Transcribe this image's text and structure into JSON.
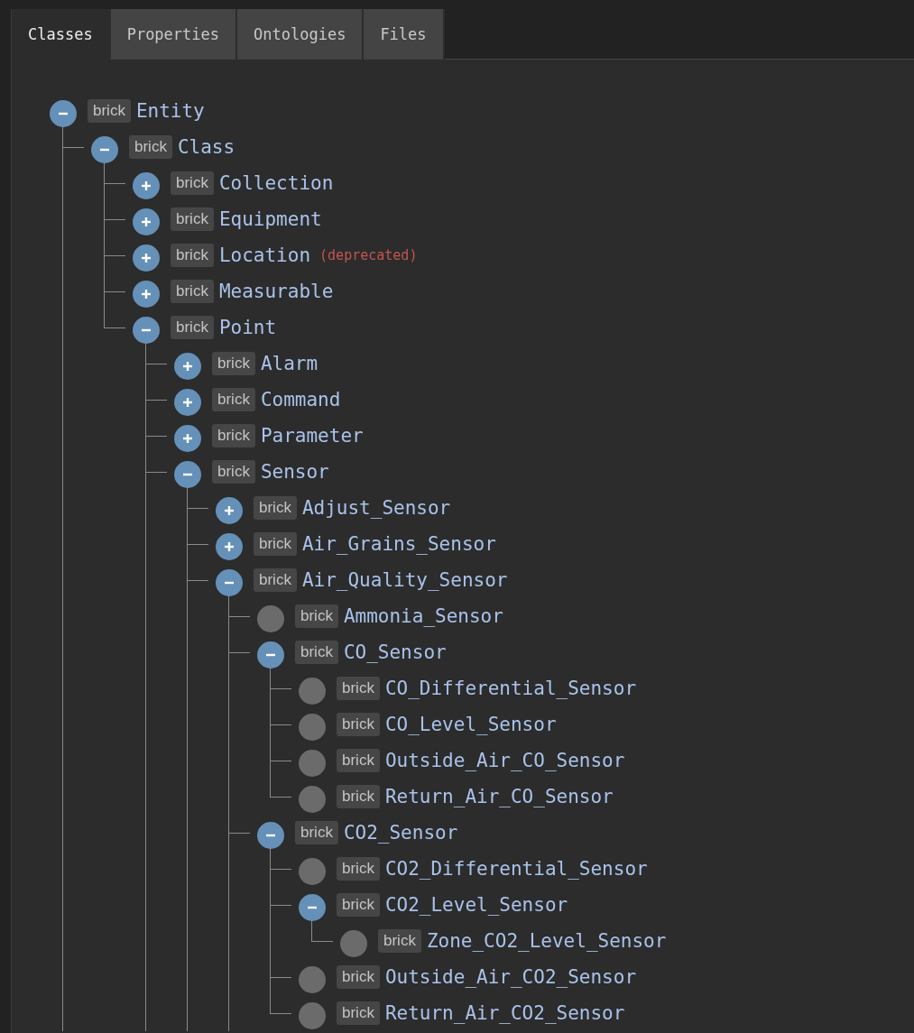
{
  "tabs": [
    {
      "label": "Classes",
      "selected": true
    },
    {
      "label": "Properties",
      "selected": false
    },
    {
      "label": "Ontologies",
      "selected": false
    },
    {
      "label": "Files",
      "selected": false
    }
  ],
  "tree": [
    {
      "prefix": "brick",
      "label": "Entity",
      "kind": "branch",
      "expanded": true,
      "continues": true,
      "children": [
        {
          "prefix": "brick",
          "label": "Class",
          "kind": "branch",
          "expanded": true,
          "children": [
            {
              "prefix": "brick",
              "label": "Collection",
              "kind": "branch",
              "expanded": false
            },
            {
              "prefix": "brick",
              "label": "Equipment",
              "kind": "branch",
              "expanded": false
            },
            {
              "prefix": "brick",
              "label": "Location",
              "note": "(deprecated)",
              "kind": "branch",
              "expanded": false
            },
            {
              "prefix": "brick",
              "label": "Measurable",
              "kind": "branch",
              "expanded": false
            },
            {
              "prefix": "brick",
              "label": "Point",
              "kind": "branch",
              "expanded": true,
              "continues": true,
              "children": [
                {
                  "prefix": "brick",
                  "label": "Alarm",
                  "kind": "branch",
                  "expanded": false
                },
                {
                  "prefix": "brick",
                  "label": "Command",
                  "kind": "branch",
                  "expanded": false
                },
                {
                  "prefix": "brick",
                  "label": "Parameter",
                  "kind": "branch",
                  "expanded": false
                },
                {
                  "prefix": "brick",
                  "label": "Sensor",
                  "kind": "branch",
                  "expanded": true,
                  "continues": true,
                  "children": [
                    {
                      "prefix": "brick",
                      "label": "Adjust_Sensor",
                      "kind": "branch",
                      "expanded": false
                    },
                    {
                      "prefix": "brick",
                      "label": "Air_Grains_Sensor",
                      "kind": "branch",
                      "expanded": false
                    },
                    {
                      "prefix": "brick",
                      "label": "Air_Quality_Sensor",
                      "kind": "branch",
                      "expanded": true,
                      "continues": true,
                      "children": [
                        {
                          "prefix": "brick",
                          "label": "Ammonia_Sensor",
                          "kind": "leaf"
                        },
                        {
                          "prefix": "brick",
                          "label": "CO_Sensor",
                          "kind": "branch",
                          "expanded": true,
                          "children": [
                            {
                              "prefix": "brick",
                              "label": "CO_Differential_Sensor",
                              "kind": "leaf"
                            },
                            {
                              "prefix": "brick",
                              "label": "CO_Level_Sensor",
                              "kind": "leaf"
                            },
                            {
                              "prefix": "brick",
                              "label": "Outside_Air_CO_Sensor",
                              "kind": "leaf"
                            },
                            {
                              "prefix": "brick",
                              "label": "Return_Air_CO_Sensor",
                              "kind": "leaf"
                            }
                          ]
                        },
                        {
                          "prefix": "brick",
                          "label": "CO2_Sensor",
                          "kind": "branch",
                          "expanded": true,
                          "children": [
                            {
                              "prefix": "brick",
                              "label": "CO2_Differential_Sensor",
                              "kind": "leaf"
                            },
                            {
                              "prefix": "brick",
                              "label": "CO2_Level_Sensor",
                              "kind": "branch",
                              "expanded": true,
                              "children": [
                                {
                                  "prefix": "brick",
                                  "label": "Zone_CO2_Level_Sensor",
                                  "kind": "leaf"
                                }
                              ]
                            },
                            {
                              "prefix": "brick",
                              "label": "Outside_Air_CO2_Sensor",
                              "kind": "leaf"
                            },
                            {
                              "prefix": "brick",
                              "label": "Return_Air_CO2_Sensor",
                              "kind": "leaf"
                            }
                          ]
                        }
                      ]
                    }
                  ]
                }
              ]
            }
          ]
        }
      ]
    }
  ]
}
